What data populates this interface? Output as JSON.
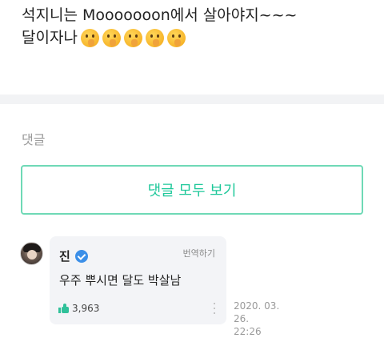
{
  "post": {
    "line1": "석지니는 Mooooooon에서 살아야지~~~",
    "line2": "달이자나",
    "emojis": [
      "shushing-face-icon",
      "shushing-face-icon",
      "shushing-face-icon",
      "shushing-face-icon",
      "shushing-face-icon"
    ]
  },
  "comments": {
    "section_label": "댓글",
    "view_all_label": "댓글 모두 보기",
    "items": [
      {
        "author": "진",
        "verified": true,
        "translate_label": "번역하기",
        "text": "우주 뿌시면 달도 박살남",
        "likes": "3,963",
        "date": "2020. 03. 26.",
        "time": "22:26"
      }
    ]
  },
  "colors": {
    "accent": "#1ec89a",
    "button_border": "#6fd9b6",
    "verified": "#3b8fe8",
    "card_bg": "#f3f4f7",
    "divider": "#f2f3f5"
  }
}
